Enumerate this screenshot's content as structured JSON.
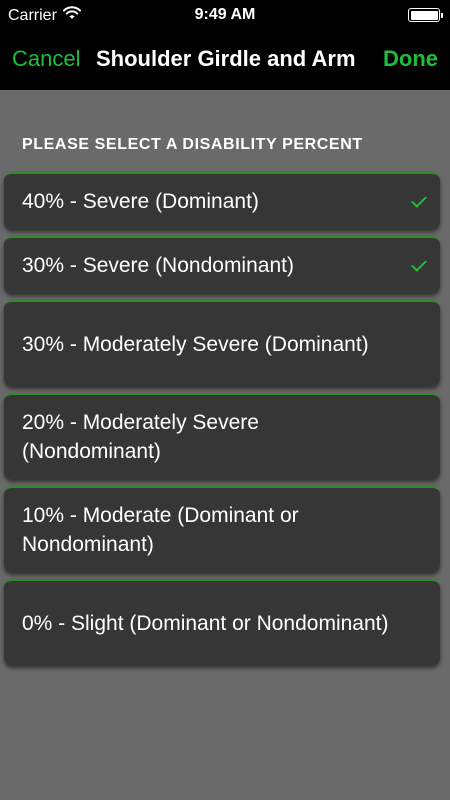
{
  "status_bar": {
    "carrier": "Carrier",
    "time": "9:49 AM"
  },
  "nav": {
    "cancel_label": "Cancel",
    "title": "Shoulder Girdle and Arm",
    "done_label": "Done"
  },
  "section_header": "PLEASE SELECT A DISABILITY PERCENT",
  "options": [
    {
      "label": "40% - Severe (Dominant)",
      "selected": true
    },
    {
      "label": "30% - Severe (Nondominant)",
      "selected": true
    },
    {
      "label": "30% - Moderately Severe (Dominant)",
      "selected": false
    },
    {
      "label": "20% - Moderately Severe (Nondominant)",
      "selected": false
    },
    {
      "label": "10% - Moderate (Dominant or Nondominant)",
      "selected": false
    },
    {
      "label": "0% - Slight (Dominant or Nondominant)",
      "selected": false
    }
  ],
  "colors": {
    "accent": "#1bbf3c",
    "background": "#6a6a6a",
    "option_background": "#363636"
  },
  "icons": [
    "wifi-icon",
    "battery-icon",
    "checkmark-icon"
  ]
}
